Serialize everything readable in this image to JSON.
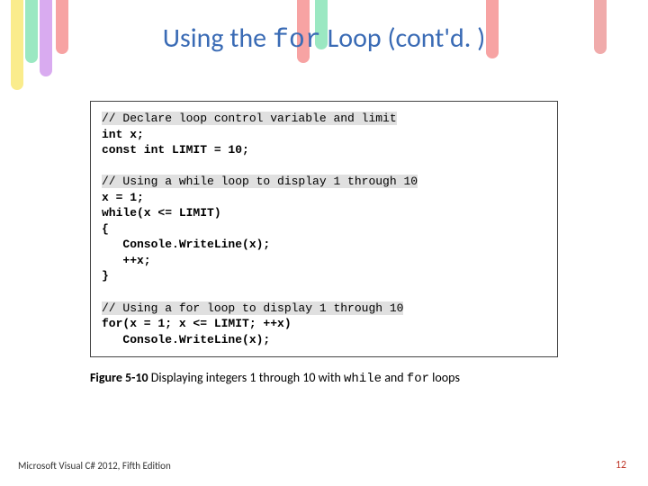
{
  "title": {
    "prefix": "Using the ",
    "mono": "for",
    "suffix": " Loop (cont'd. )"
  },
  "code": {
    "comment1": "// Declare loop control variable and limit",
    "l2": "int x;",
    "l3": "const int LIMIT = 10;",
    "comment2": "// Using a while loop to display 1 through 10",
    "l4": "x = 1;",
    "l5": "while(x <= LIMIT)",
    "l6": "{",
    "l7": "   Console.WriteLine(x);",
    "l8": "   ++x;",
    "l9": "}",
    "comment3": "// Using a for loop to display 1 through 10",
    "l10": "for(x = 1; x <= LIMIT; ++x)",
    "l11": "   Console.WriteLine(x);"
  },
  "caption": {
    "label": "Figure 5-10",
    "textA": " Displaying integers 1 through 10 with ",
    "monoA": "while",
    "textB": " and ",
    "monoB": "for",
    "textC": " loops"
  },
  "footer": {
    "left": "Microsoft Visual C# 2012, Fifth Edition",
    "right": "12"
  }
}
